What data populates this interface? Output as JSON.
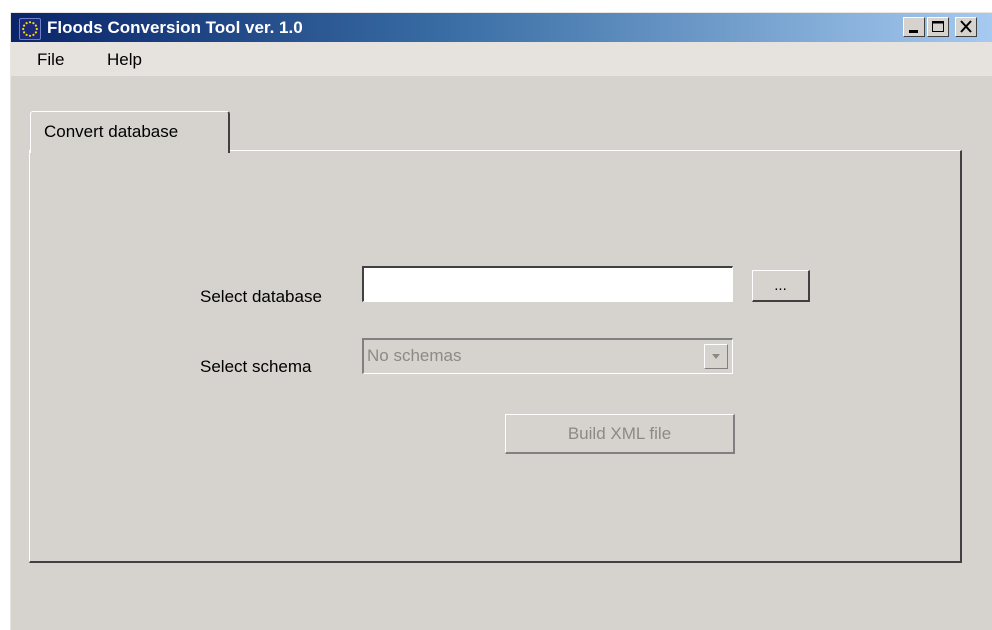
{
  "window": {
    "title": "Floods Conversion Tool ver. 1.0",
    "icon": "eu-flag-icon",
    "controls": [
      "minimize-icon",
      "maximize-icon",
      "close-icon"
    ]
  },
  "menu": {
    "items": [
      {
        "label": "File"
      },
      {
        "label": "Help"
      }
    ]
  },
  "tabs": [
    {
      "label": "Convert database",
      "active": true
    }
  ],
  "form": {
    "database_label": "Select database",
    "database_value": "",
    "browse_label": "...",
    "schema_label": "Select schema",
    "schema_value": "No schemas",
    "schema_enabled": false,
    "build_label": "Build XML file",
    "build_enabled": false
  },
  "colors": {
    "titlebar_start": "#0a246a",
    "titlebar_end": "#a6caf0",
    "face": "#d6d3ce",
    "disabled_text": "#8c8a86"
  }
}
